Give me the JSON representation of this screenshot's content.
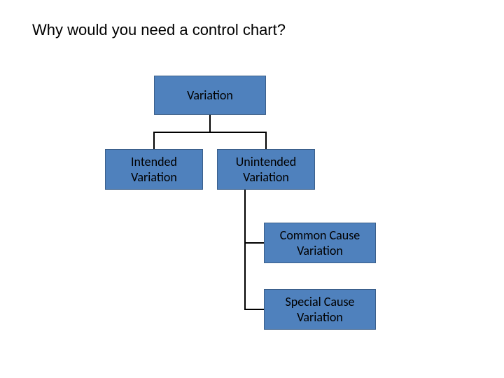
{
  "title": "Why would you need a control chart?",
  "nodes": {
    "root": "Variation",
    "left": "Intended Variation",
    "right": "Unintended Variation",
    "child1": "Common Cause Variation",
    "child2": "Special Cause Variation"
  }
}
